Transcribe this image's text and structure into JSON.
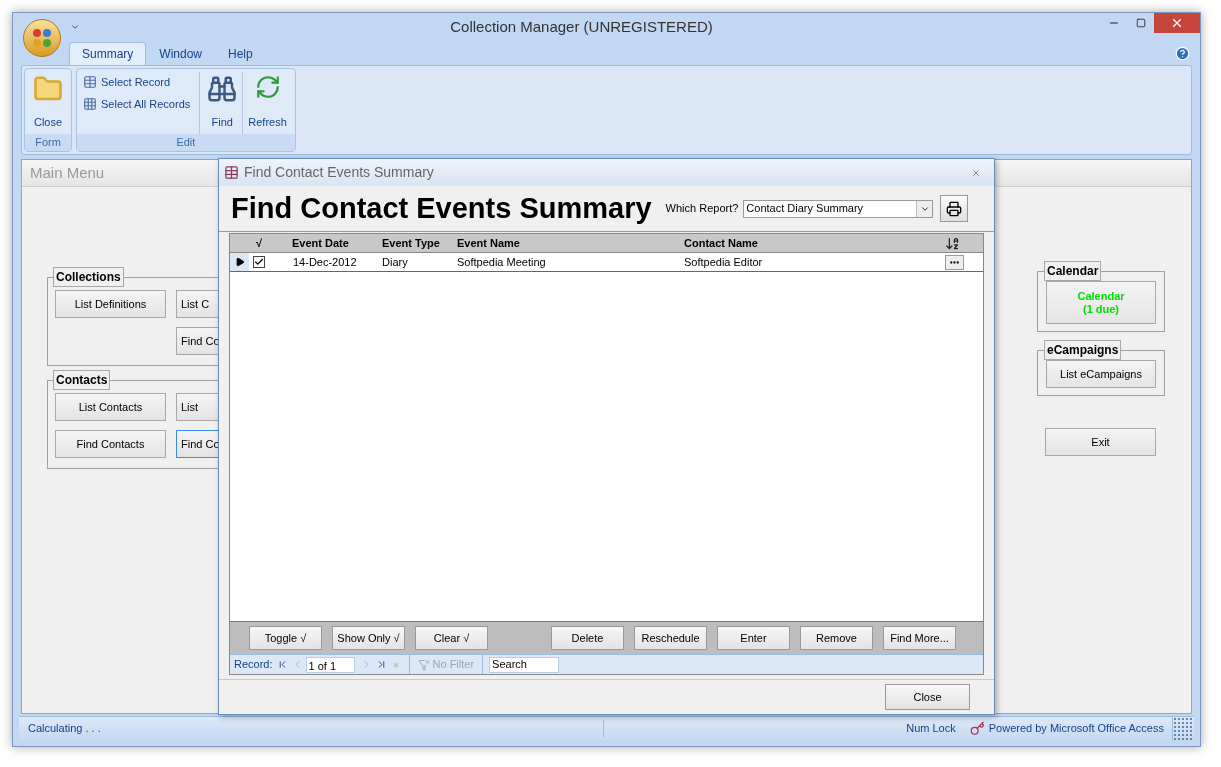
{
  "window": {
    "title": "Collection Manager (UNREGISTERED)"
  },
  "ribbon_tabs": [
    {
      "label": "Summary",
      "selected": true
    },
    {
      "label": "Window",
      "selected": false
    },
    {
      "label": "Help",
      "selected": false
    }
  ],
  "ribbon_groups": [
    {
      "label": "Form",
      "items": [
        {
          "kind": "large",
          "label": "Close"
        }
      ]
    },
    {
      "label": "Edit",
      "items": [
        {
          "kind": "small",
          "label": "Select Record"
        },
        {
          "kind": "small",
          "label": "Select All Records"
        },
        {
          "kind": "large",
          "label": "Find"
        },
        {
          "kind": "large",
          "label": "Refresh"
        }
      ]
    }
  ],
  "main_menu": {
    "title": "Main Menu",
    "left_groups": [
      {
        "label": "Collections",
        "rows": [
          [
            {
              "label": "List Definitions",
              "kind": "full",
              "focused": false
            },
            {
              "label": "List C",
              "kind": "cut",
              "focused": false
            }
          ],
          [
            "",
            {
              "label": "Find Co",
              "kind": "cut",
              "focused": false
            }
          ]
        ]
      },
      {
        "label": "Contacts",
        "rows": [
          [
            {
              "label": "List Contacts",
              "kind": "full",
              "focused": false
            },
            {
              "label": "List",
              "kind": "cut",
              "focused": false
            }
          ],
          [
            {
              "label": "Find Contacts",
              "kind": "full",
              "focused": false
            },
            {
              "label": "Find Co",
              "kind": "cut",
              "focused": true
            }
          ]
        ]
      }
    ],
    "right_groups": [
      {
        "label": "Calendar",
        "button": {
          "label": "Calendar\n(1 due)",
          "alert": true
        }
      },
      {
        "label": "eCampaigns",
        "button": {
          "label": "List eCampaigns",
          "alert": false
        }
      }
    ],
    "exit_button": "Exit"
  },
  "dialog": {
    "title": "Find Contact Events Summary",
    "heading": "Find Contact Events Summary",
    "report_label": "Which Report?",
    "report_value": "Contact Diary Summary",
    "check_column": "√",
    "columns": [
      "Event Date",
      "Event Type",
      "Event Name",
      "Contact Name"
    ],
    "rows": [
      {
        "selected": true,
        "checked": true,
        "cells": [
          "14-Dec-2012",
          "Diary",
          "Softpedia Meeting",
          "Softpedia Editor"
        ]
      }
    ],
    "left_buttons": [
      "Toggle √",
      "Show Only √",
      "Clear √"
    ],
    "right_buttons": [
      "Delete",
      "Reschedule",
      "Enter",
      "Remove",
      "Find More..."
    ],
    "nav": {
      "label": "Record:",
      "position": "1 of 1",
      "filter": "No Filter",
      "filter_active": false,
      "search_placeholder": "Search"
    },
    "close_button": "Close"
  },
  "status_bar": {
    "left": "Calculating . . .",
    "num_lock": "Num Lock",
    "powered_by": "Powered by Microsoft Office Access"
  }
}
